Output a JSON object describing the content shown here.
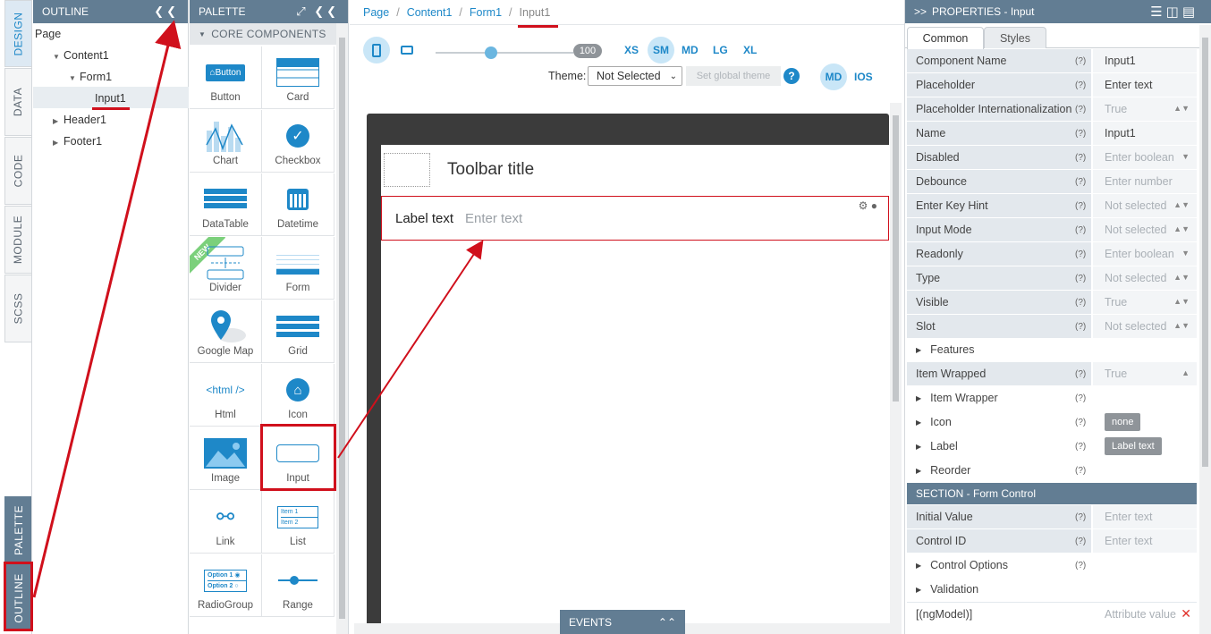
{
  "rail": {
    "tabs": [
      "DESIGN",
      "DATA",
      "CODE",
      "MODULE",
      "SCSS"
    ],
    "bottom_tabs": [
      "PALETTE",
      "OUTLINE"
    ]
  },
  "outline": {
    "title": "OUTLINE",
    "tree": [
      "Page",
      "Content1",
      "Form1",
      "Input1",
      "Header1",
      "Footer1"
    ]
  },
  "palette": {
    "title": "PALETTE",
    "section": "CORE COMPONENTS",
    "items": [
      "Button",
      "Card",
      "Chart",
      "Checkbox",
      "DataTable",
      "Datetime",
      "Divider",
      "Form",
      "Google Map",
      "Grid",
      "Html",
      "Icon",
      "Image",
      "Input",
      "Link",
      "List",
      "RadioGroup",
      "Range"
    ],
    "button_preview": "Button",
    "html_preview": "<html />",
    "new_badge": "NEW",
    "list_preview": [
      "Item 1",
      "Item 2"
    ],
    "radio_preview": [
      "Option 1",
      "Option 2"
    ]
  },
  "canvas": {
    "breadcrumb": [
      "Page",
      "Content1",
      "Form1",
      "Input1"
    ],
    "zoom": "100",
    "zoom_level": 0.4,
    "breakpoints": [
      "XS",
      "SM",
      "MD",
      "LG",
      "XL"
    ],
    "active_breakpoint": "SM",
    "theme_label": "Theme:",
    "theme_value": "Not Selected",
    "global_theme_button": "Set global theme",
    "help": "?",
    "modes": [
      "MD",
      "IOS"
    ],
    "toolbar_title": "Toolbar title",
    "input_label": "Label text",
    "input_placeholder": "Enter text",
    "events": "EVENTS"
  },
  "properties": {
    "title": "PROPERTIES - Input",
    "tabs": [
      "Common",
      "Styles"
    ],
    "rows": [
      {
        "k": "Component Name",
        "v": "Input1",
        "ph": false,
        "arr": ""
      },
      {
        "k": "Placeholder",
        "v": "Enter text",
        "ph": false,
        "arr": ""
      },
      {
        "k": "Placeholder Internationalization",
        "v": "True",
        "ph": true,
        "arr": "updown"
      },
      {
        "k": "Name",
        "v": "Input1",
        "ph": false,
        "arr": ""
      },
      {
        "k": "Disabled",
        "v": "Enter boolean",
        "ph": true,
        "arr": "down"
      },
      {
        "k": "Debounce",
        "v": "Enter number",
        "ph": true,
        "arr": ""
      },
      {
        "k": "Enter Key Hint",
        "v": "Not selected",
        "ph": true,
        "arr": "updown"
      },
      {
        "k": "Input Mode",
        "v": "Not selected",
        "ph": true,
        "arr": "updown"
      },
      {
        "k": "Readonly",
        "v": "Enter boolean",
        "ph": true,
        "arr": "down"
      },
      {
        "k": "Type",
        "v": "Not selected",
        "ph": true,
        "arr": "updown"
      },
      {
        "k": "Visible",
        "v": "True",
        "ph": true,
        "arr": "updown"
      },
      {
        "k": "Slot",
        "v": "Not selected",
        "ph": true,
        "arr": "updown"
      }
    ],
    "features": "Features",
    "item_wrapped": {
      "k": "Item Wrapped",
      "v": "True"
    },
    "groups": [
      "Item Wrapper",
      "Icon",
      "Label",
      "Reorder"
    ],
    "icon_pill": "none",
    "label_pill": "Label text",
    "section": "SECTION - Form Control",
    "form_rows": [
      {
        "k": "Initial Value",
        "v": "Enter text"
      },
      {
        "k": "Control ID",
        "v": "Enter text"
      }
    ],
    "groups2": [
      "Control Options",
      "Validation"
    ],
    "ngmodel": {
      "k": "[(ngModel)]",
      "v": "Attribute value"
    },
    "q": "(?)"
  }
}
